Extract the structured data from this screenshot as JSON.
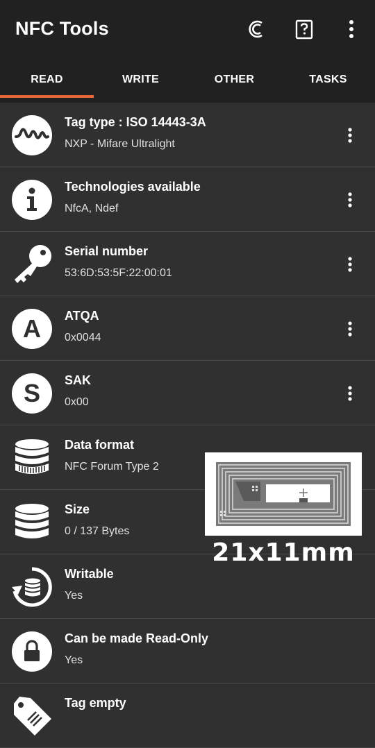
{
  "app": {
    "title": "NFC Tools"
  },
  "actions": {
    "icons": [
      "credit-icon",
      "help-icon",
      "overflow-menu-icon"
    ]
  },
  "tabs": [
    {
      "label": "READ",
      "selected": true
    },
    {
      "label": "WRITE",
      "selected": false
    },
    {
      "label": "OTHER",
      "selected": false
    },
    {
      "label": "TASKS",
      "selected": false
    }
  ],
  "accent_color": "#e8673a",
  "items": [
    {
      "label": "Tag type : ISO 14443-3A",
      "value": "NXP - Mifare Ultralight",
      "icon": "wave-icon"
    },
    {
      "label": "Technologies available",
      "value": "NfcA, Ndef",
      "icon": "info-icon"
    },
    {
      "label": "Serial number",
      "value": "53:6D:53:5F:22:00:01",
      "icon": "key-icon"
    },
    {
      "label": "ATQA",
      "value": "0x0044",
      "icon": "letter-a-icon"
    },
    {
      "label": "SAK",
      "value": "0x00",
      "icon": "letter-s-icon"
    },
    {
      "label": "Data format",
      "value": "NFC Forum Type 2",
      "icon": "database-icon"
    },
    {
      "label": "Size",
      "value": "0 / 137 Bytes",
      "icon": "database-icon"
    },
    {
      "label": "Writable",
      "value": "Yes",
      "icon": "refresh-database-icon"
    },
    {
      "label": "Can be made Read-Only",
      "value": "Yes",
      "icon": "lock-icon"
    },
    {
      "label": "Tag empty",
      "value": "",
      "icon": "tag-icon"
    }
  ],
  "overlay": {
    "caption": "21x11mm",
    "image": "nfc-antenna-photo"
  }
}
